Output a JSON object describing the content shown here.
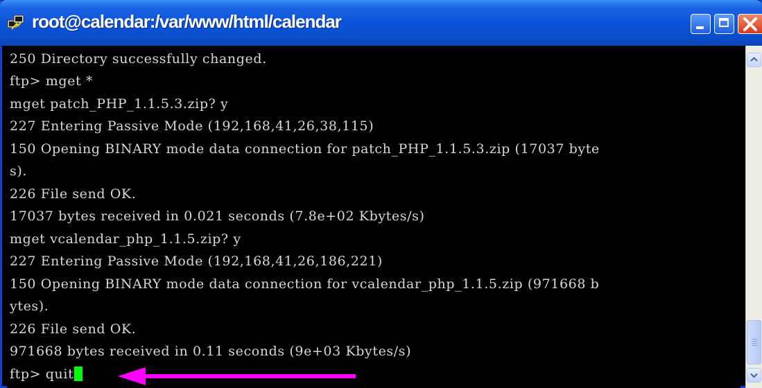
{
  "window": {
    "title": "root@calendar:/var/www/html/calendar",
    "icon": "putty-terminal-icon",
    "controls": [
      "minimize-icon",
      "maximize-icon",
      "close-icon"
    ],
    "title_color": "#0b54d9",
    "close_color": "#d83a18"
  },
  "terminal": {
    "lines": [
      "250 Directory successfully changed.",
      "ftp> mget *",
      "mget patch_PHP_1.1.5.3.zip? y",
      "227 Entering Passive Mode (192,168,41,26,38,115)",
      "150 Opening BINARY mode data connection for patch_PHP_1.1.5.3.zip (17037 byte",
      "s).",
      "226 File send OK.",
      "17037 bytes received in 0.021 seconds (7.8e+02 Kbytes/s)",
      "mget vcalendar_php_1.1.5.zip? y",
      "227 Entering Passive Mode (192,168,41,26,186,221)",
      "150 Opening BINARY mode data connection for vcalendar_php_1.1.5.zip (971668 b",
      "ytes).",
      "226 File send OK.",
      "971668 bytes received in 0.11 seconds (9e+03 Kbytes/s)"
    ],
    "prompt": "ftp> quit",
    "text_color": "#d8d8d8",
    "background_color": "#000000",
    "cursor_color": "#00ff00"
  },
  "annotation": {
    "icon": "arrow-left-icon",
    "color": "#ff00ff"
  },
  "scrollbar": {
    "up_icon": "chevron-up-icon",
    "down_icon": "chevron-down-icon"
  }
}
